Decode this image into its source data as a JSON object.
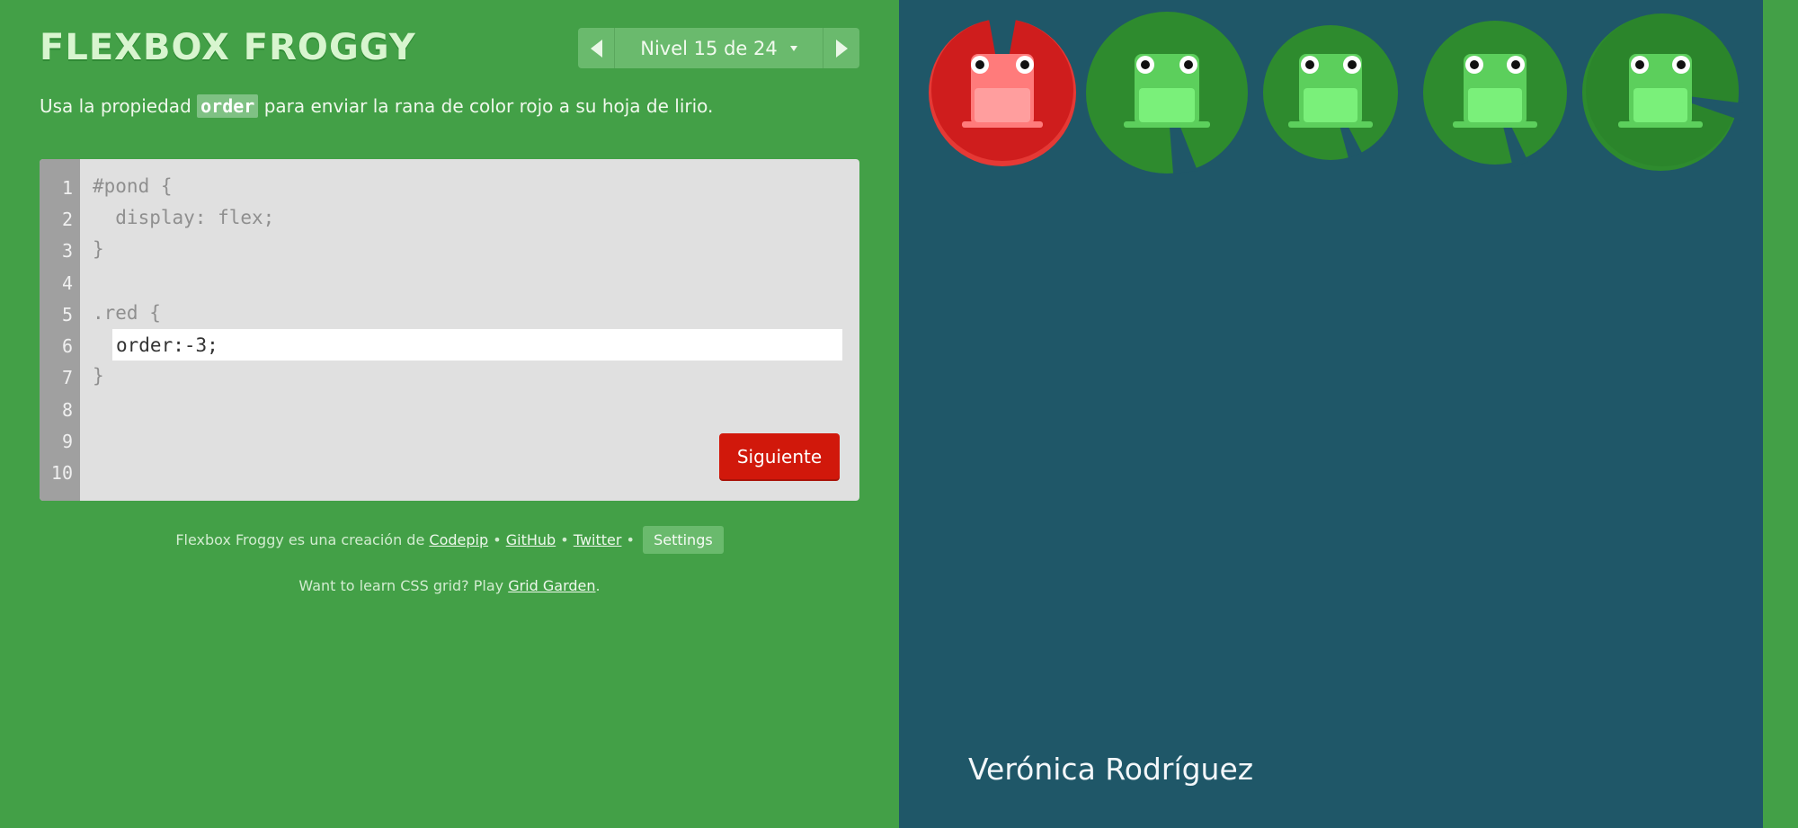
{
  "app": {
    "title": "FLEXBOX FROGGY"
  },
  "level_nav": {
    "label": "Nivel 15 de 24",
    "prev_icon": "chevron-left-icon",
    "next_icon": "chevron-right-icon"
  },
  "instructions": {
    "before": "Usa la propiedad ",
    "code": "order",
    "after": " para enviar la rana de color rojo a su hoja de lirio."
  },
  "editor": {
    "line_numbers": [
      "1",
      "2",
      "3",
      "4",
      "5",
      "6",
      "7",
      "8",
      "9",
      "10"
    ],
    "lines": [
      "#pond {",
      "  display: flex;",
      "}",
      "",
      ".red {",
      "",
      "}"
    ],
    "input_value": "order:-3;",
    "next_button": "Siguiente"
  },
  "credits": {
    "text": "Flexbox Froggy es una creación de",
    "codepip": "Codepip",
    "sep": "•",
    "github": "GitHub",
    "twitter": "Twitter",
    "settings": "Settings"
  },
  "grid_promo": {
    "text": "Want to learn CSS grid? Play",
    "link": "Grid Garden",
    "end": "."
  },
  "pond": {
    "frogs": [
      {
        "color": "red",
        "pad_color": "#d62020"
      },
      {
        "color": "green",
        "pad_color": "#2e8b2e"
      },
      {
        "color": "green",
        "pad_color": "#2e8b2e"
      },
      {
        "color": "green",
        "pad_color": "#2e8b2e"
      },
      {
        "color": "green",
        "pad_color": "#2e8b2e"
      }
    ]
  },
  "signature": "Verónica Rodríguez",
  "colors": {
    "sidebar_bg": "#43a047",
    "pond_bg": "#1f5768",
    "next_button": "#d1180b",
    "red_frog": "#ff8a8a",
    "green_frog": "#6fd96f"
  }
}
